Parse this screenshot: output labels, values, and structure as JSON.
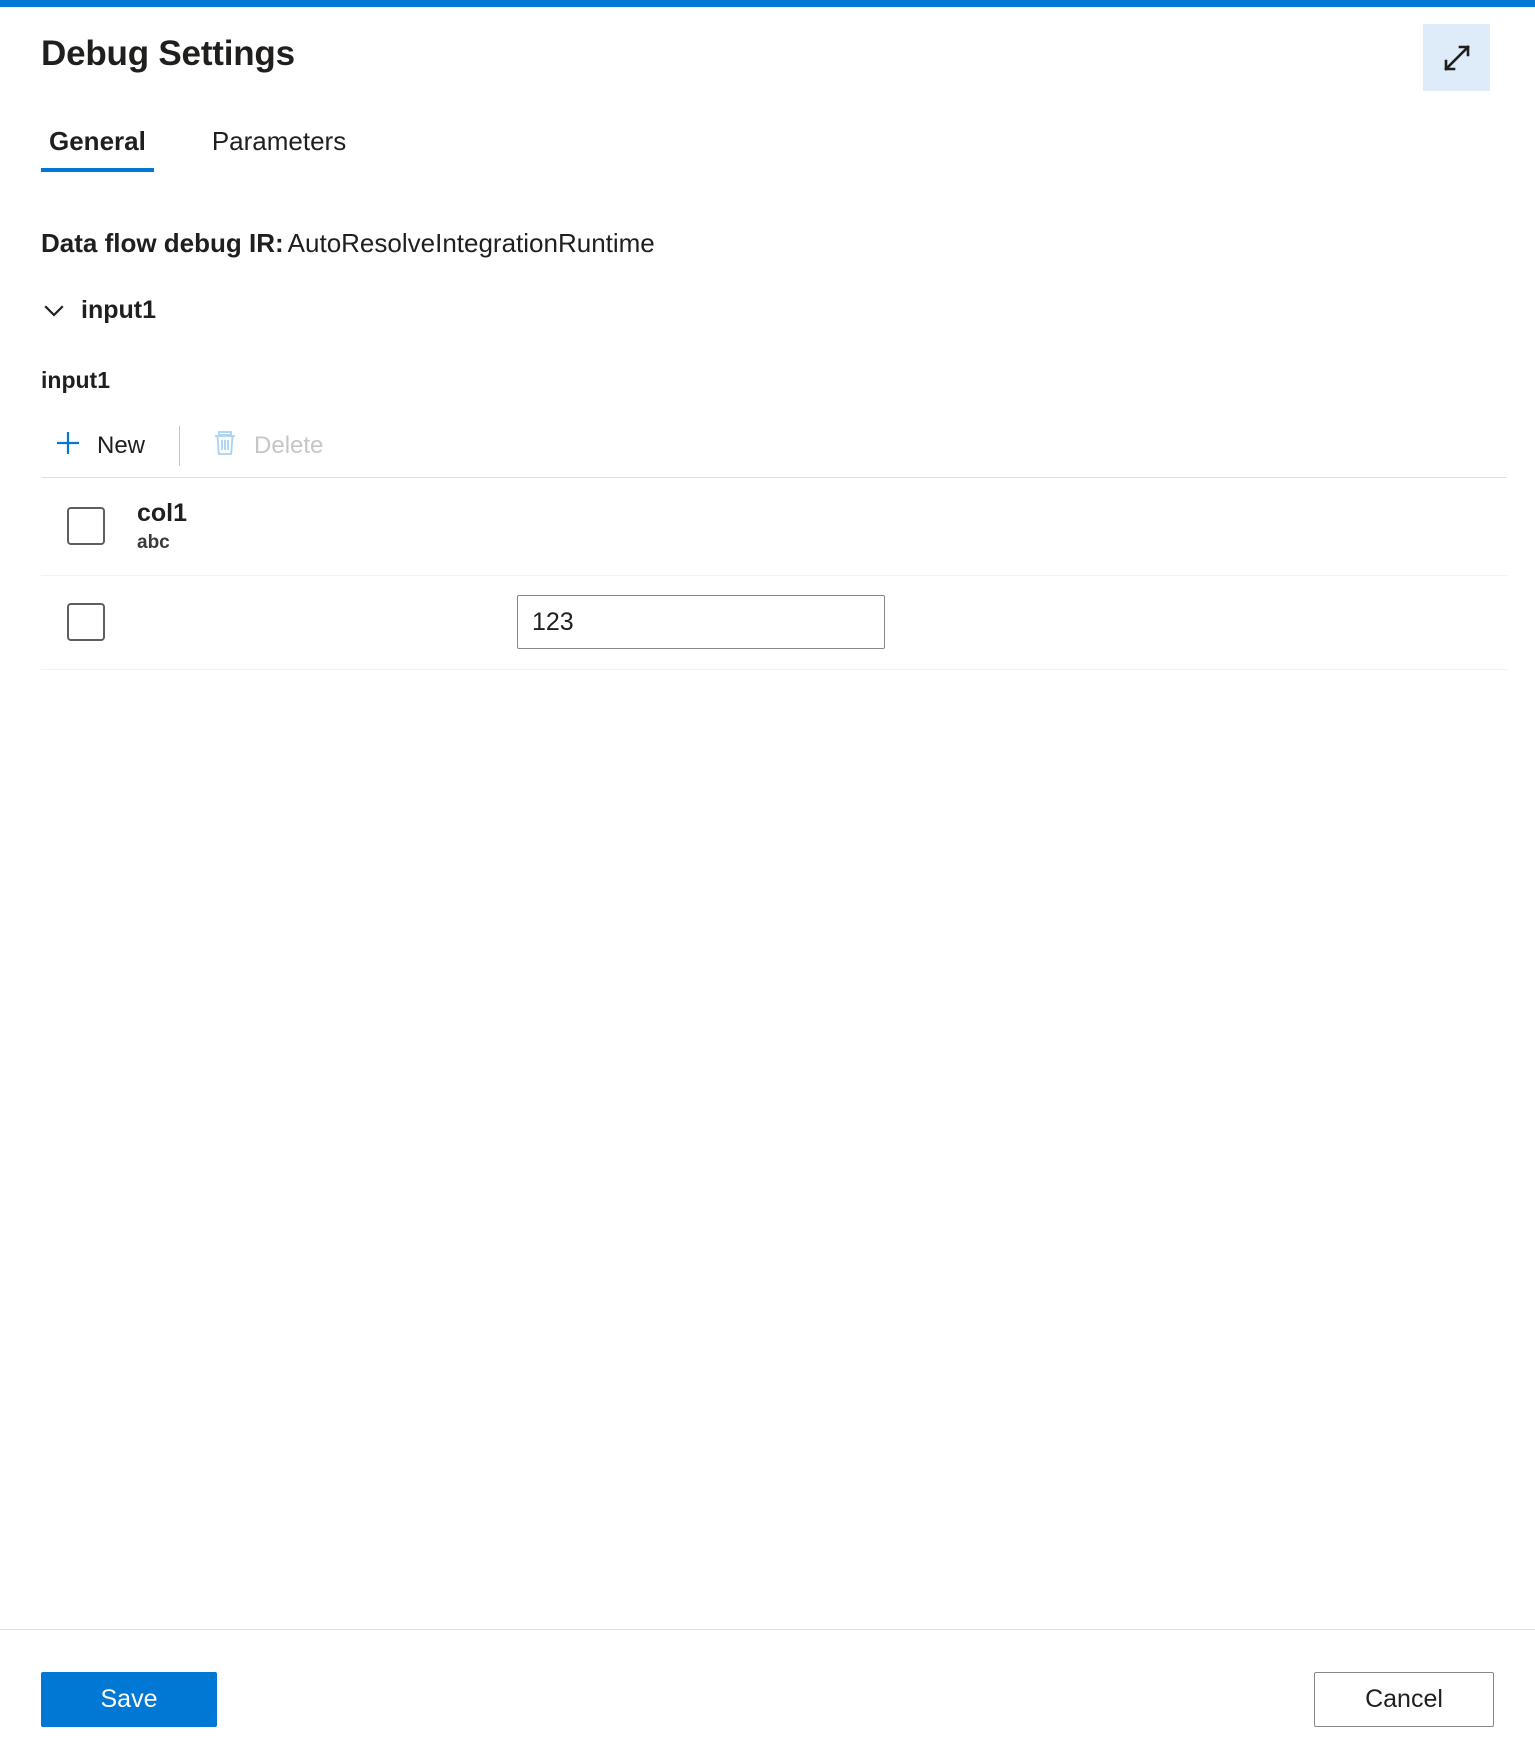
{
  "theme": {
    "accent": "#0078d4",
    "accent_soft": "#deecf9",
    "text": "#201f1e",
    "disabled_text": "#c8c6c4",
    "border": "#8a8886",
    "row_divider": "#f3f2f1"
  },
  "header": {
    "title": "Debug Settings",
    "expand_icon": "expand-diagonal-icon"
  },
  "tabs": [
    {
      "label": "General",
      "active": true
    },
    {
      "label": "Parameters",
      "active": false
    }
  ],
  "general": {
    "ir_label": "Data flow debug IR:",
    "ir_value": "AutoResolveIntegrationRuntime",
    "collapsible": {
      "label": "input1",
      "icon": "chevron-down-icon",
      "expanded": true
    },
    "section_name": "input1",
    "toolbar": {
      "new": {
        "label": "New",
        "icon": "plus-icon",
        "disabled": false
      },
      "delete": {
        "label": "Delete",
        "icon": "trash-icon",
        "disabled": true
      }
    },
    "table": {
      "columns": [
        {
          "name": "col1",
          "type": "abc"
        }
      ],
      "rows": [
        {
          "checked": false,
          "values": [
            "123"
          ]
        }
      ]
    }
  },
  "footer": {
    "save_label": "Save",
    "cancel_label": "Cancel"
  }
}
